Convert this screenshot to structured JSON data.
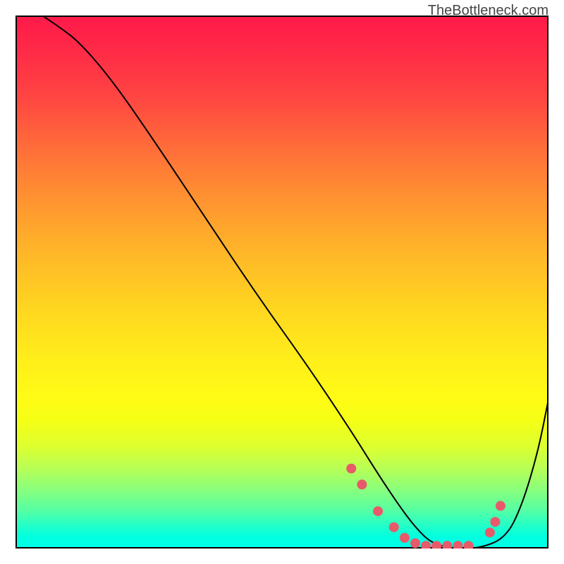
{
  "watermark": "TheBottleneck.com",
  "chart_data": {
    "type": "line",
    "title": "",
    "xlabel": "",
    "ylabel": "",
    "xlim": [
      0,
      100
    ],
    "ylim": [
      0,
      100
    ],
    "curve": {
      "x": [
        5,
        8,
        12,
        18,
        25,
        35,
        45,
        55,
        63,
        68,
        72,
        75,
        78,
        82,
        87,
        92,
        95,
        98,
        100
      ],
      "y": [
        100,
        98,
        95,
        88,
        78,
        63,
        48,
        34,
        22,
        14,
        8,
        4,
        1,
        0,
        0,
        2,
        8,
        18,
        28
      ]
    },
    "dots": {
      "x": [
        63,
        65,
        68,
        71,
        73,
        75,
        77,
        79,
        81,
        83,
        85,
        89,
        90,
        91
      ],
      "y": [
        15,
        12,
        7,
        4,
        2,
        1,
        0.5,
        0.5,
        0.5,
        0.5,
        0.5,
        3,
        5,
        8
      ]
    },
    "gradient": {
      "colors": [
        "#ff1a4a",
        "#ff6e39",
        "#ffd620",
        "#fffb15",
        "#60ffa0",
        "#00e8d0"
      ],
      "stops": [
        0,
        0.3,
        0.6,
        0.75,
        0.9,
        1.0
      ]
    }
  }
}
